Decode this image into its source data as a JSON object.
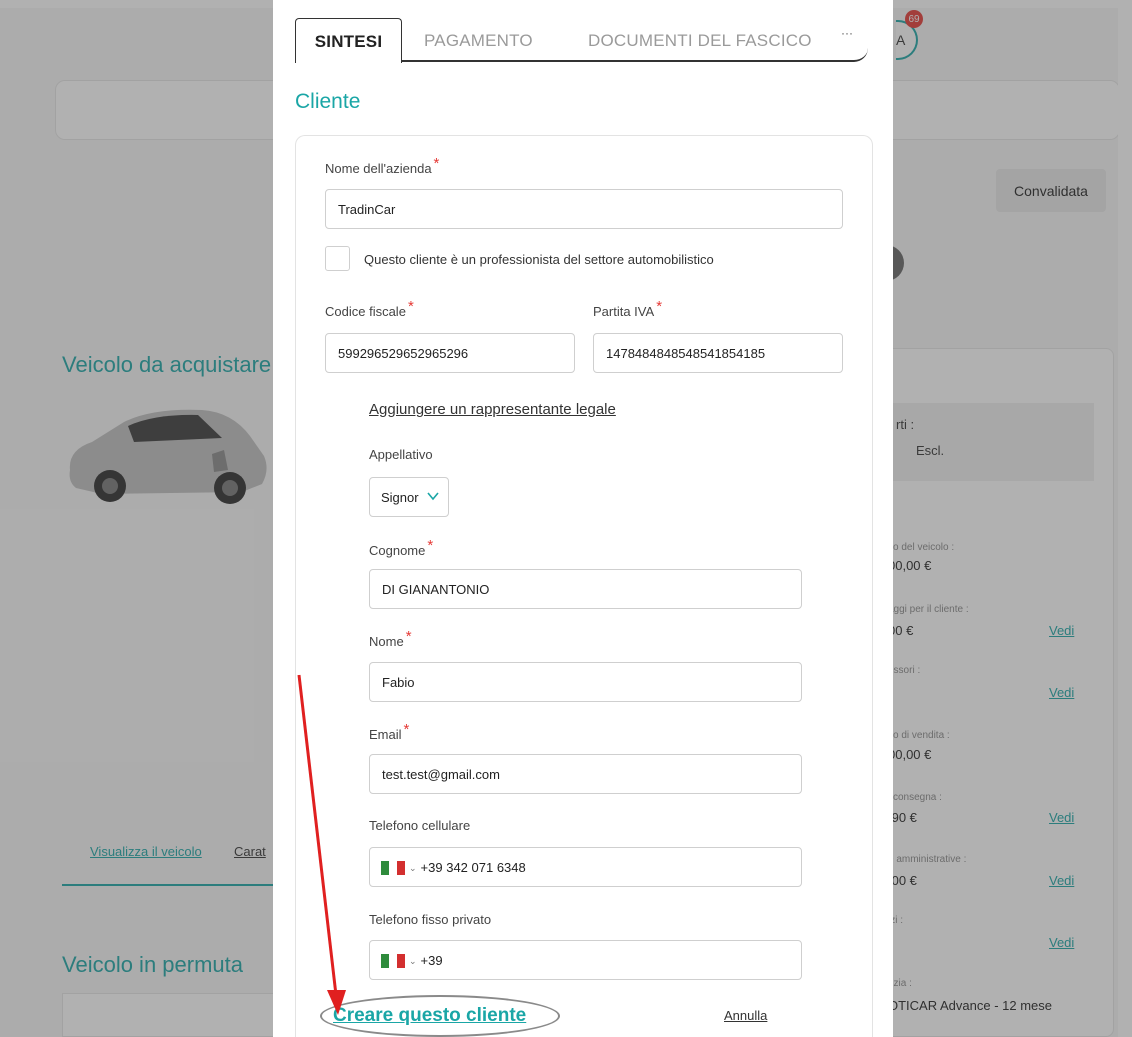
{
  "background": {
    "avatar_initial": "A",
    "notification_count": "69",
    "status_button": "Convalidata",
    "vehicle_to_buy_title": "Veicolo da acquistare",
    "vehicle_tabs": {
      "view_vehicle": "Visualizza il veicolo",
      "features": "Carat"
    },
    "trade_in_title": "Veicolo in permuta",
    "side_panel": {
      "box_line1": "rti :",
      "box_line2": "Escl.",
      "rows": [
        {
          "label": "zo del veicolo :",
          "value": "00,00 €",
          "link": ""
        },
        {
          "label": "aggi per il cliente :",
          "value": "00 €",
          "link": "Vedi"
        },
        {
          "label": "essori :",
          "value": "",
          "link": "Vedi"
        },
        {
          "label": "zo di vendita :",
          "value": "00,00 €",
          "link": ""
        },
        {
          "label": "i consegna :",
          "value": ",90 €",
          "link": "Vedi"
        },
        {
          "label": "e amministrative :",
          "value": ",00 €",
          "link": "Vedi"
        },
        {
          "label": "izi :",
          "value": "",
          "link": "Vedi"
        },
        {
          "label": "nzia :",
          "value": "OTICAR Advance - 12 mese",
          "link": ""
        }
      ]
    }
  },
  "modal": {
    "tabs": [
      "SINTESI",
      "PAGAMENTO",
      "DOCUMENTI DEL FASCICO"
    ],
    "tabs_more": "···",
    "section_title": "Cliente",
    "form": {
      "company_name_label": "Nome dell'azienda",
      "company_name_value": "TradinCar",
      "professional_checkbox_label": "Questo cliente è un professionista del settore automobilistico",
      "tax_code_label": "Codice fiscale",
      "tax_code_value": "599296529652965296",
      "vat_label": "Partita IVA",
      "vat_value": "1478484848548541854185",
      "add_legal_rep_link": "Aggiungere un rappresentante legale",
      "title_label": "Appellativo",
      "title_value": "Signor",
      "surname_label": "Cognome",
      "surname_value": "DI GIANANTONIO",
      "name_label": "Nome",
      "name_value": "Fabio",
      "email_label": "Email",
      "email_value": "test.test@gmail.com",
      "mobile_label": "Telefono cellulare",
      "mobile_value": "+39 342 071 6348",
      "landline_label": "Telefono fisso privato",
      "landline_value": "+39",
      "required_mark": "*"
    },
    "create_button": "Creare questo cliente",
    "cancel_button": "Annulla"
  },
  "colors": {
    "accent": "#1aa6a6",
    "required": "#e53935",
    "annotation_arrow": "#e02020"
  }
}
